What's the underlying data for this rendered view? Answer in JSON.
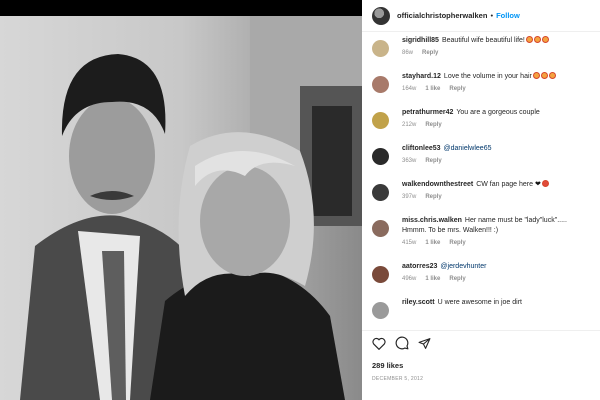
{
  "post": {
    "owner": "officialchristopherwalken",
    "separator": "•",
    "follow_label": "Follow",
    "likes": "289 likes",
    "date": "DECEMBER 5, 2012"
  },
  "icons": {
    "like": "heart-icon",
    "comment": "comment-icon",
    "share": "share-icon"
  },
  "comments": [
    {
      "user": "sigridhill85",
      "text": "Beautiful wife beautiful life!",
      "emoji_count": 3,
      "time": "86w",
      "likes": "",
      "reply": "Reply",
      "avatar_color": "#c9b48a"
    },
    {
      "user": "stayhard.12",
      "text": "Love the volume in your hair",
      "emoji_count": 3,
      "time": "164w",
      "likes": "1 like",
      "reply": "Reply",
      "avatar_color": "#a87a6a"
    },
    {
      "user": "petrathurmer42",
      "text": "You are a gorgeous couple",
      "emoji_count": 0,
      "time": "212w",
      "likes": "",
      "reply": "Reply",
      "avatar_color": "#c1a24a"
    },
    {
      "user": "cliftonlee53",
      "text": "@danielwlee65",
      "mention": true,
      "emoji_count": 0,
      "time": "363w",
      "likes": "",
      "reply": "Reply",
      "avatar_color": "#2a2a2a"
    },
    {
      "user": "walkendownthestreet",
      "text": "CW fan page here",
      "emoji_count": 0,
      "heart": "❤",
      "time": "397w",
      "likes": "",
      "reply": "Reply",
      "avatar_color": "#3a3a3a"
    },
    {
      "user": "miss.chris.walken",
      "text": "Her name must be \"lady\"luck\"..... Hmmm. To be mrs. Walken!!! :)",
      "emoji_count": 0,
      "time": "415w",
      "likes": "1 like",
      "reply": "Reply",
      "avatar_color": "#8a6b5e"
    },
    {
      "user": "aatorres23",
      "text": "@jerdevhunter",
      "mention": true,
      "emoji_count": 0,
      "time": "496w",
      "likes": "1 like",
      "reply": "Reply",
      "avatar_color": "#7a4a3a"
    },
    {
      "user": "riley.scott",
      "text": "U were awesome in joe dirt",
      "emoji_count": 0,
      "time": "",
      "likes": "",
      "reply": "",
      "avatar_color": "#9a9a9a"
    }
  ]
}
